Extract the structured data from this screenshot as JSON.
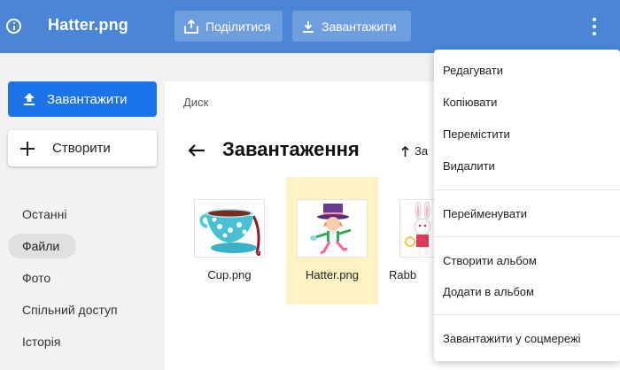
{
  "header": {
    "file_title": "Hatter.png",
    "share_label": "Поділитися",
    "download_label": "Завантажити"
  },
  "sidebar": {
    "upload_label": "Завантажити",
    "create_label": "Створити",
    "nav": [
      {
        "label": "Останні"
      },
      {
        "label": "Файли"
      },
      {
        "label": "Фото"
      },
      {
        "label": "Спільний доступ"
      },
      {
        "label": "Історія"
      }
    ]
  },
  "main": {
    "breadcrumb": "Диск",
    "folder_title": "Завантаження",
    "sort_label": "За",
    "files": [
      {
        "name": "Cup.png"
      },
      {
        "name": "Hatter.png",
        "selected": true
      },
      {
        "name": "Rabb"
      }
    ]
  },
  "menu": {
    "items": [
      "Редагувати",
      "Копіювати",
      "Перемістити",
      "Видалити",
      "Перейменувати",
      "Створити альбом",
      "Додати в альбом",
      "Завантажити у соцмережі"
    ]
  },
  "colors": {
    "header_bg": "#4b86d6",
    "upload_button": "#1a73e8",
    "selected_tile": "#fff3c4"
  }
}
